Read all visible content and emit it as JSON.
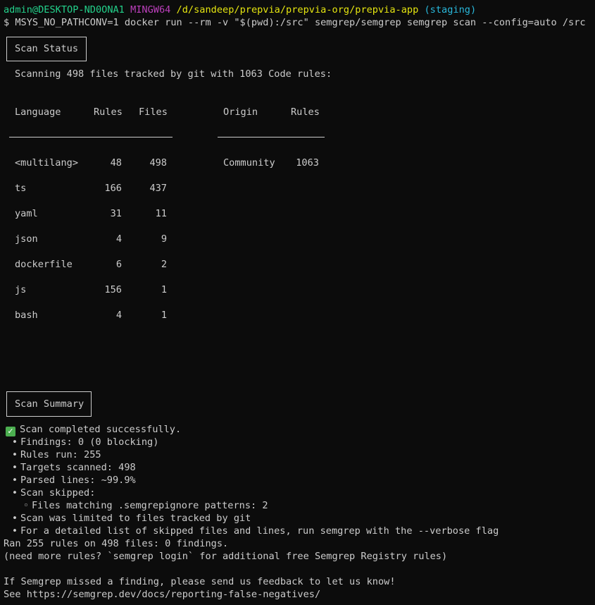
{
  "prompt": {
    "user_host": "admin@DESKTOP-ND0ONA1",
    "shell": "MINGW64",
    "path": "/d/sandeep/prepvia/prepvia-org/prepvia-app",
    "branch": "(staging)",
    "command": "$ MSYS_NO_PATHCONV=1 docker run --rm -v \"$(pwd):/src\" semgrep/semgrep semgrep scan --config=auto /src"
  },
  "scan_status": {
    "title": "Scan Status",
    "intro": "Scanning 498 files tracked by git with 1063 Code rules:",
    "lang_headers": [
      "Language",
      "Rules",
      "Files"
    ],
    "origin_headers": [
      "Origin",
      "Rules"
    ],
    "languages": [
      {
        "name": "<multilang>",
        "rules": "48",
        "files": "498"
      },
      {
        "name": "ts",
        "rules": "166",
        "files": "437"
      },
      {
        "name": "yaml",
        "rules": "31",
        "files": "11"
      },
      {
        "name": "json",
        "rules": "4",
        "files": "9"
      },
      {
        "name": "dockerfile",
        "rules": "6",
        "files": "2"
      },
      {
        "name": "js",
        "rules": "156",
        "files": "1"
      },
      {
        "name": "bash",
        "rules": "4",
        "files": "1"
      }
    ],
    "origins": [
      {
        "name": "Community",
        "rules": "1063"
      }
    ]
  },
  "scan_summary": {
    "title": "Scan Summary",
    "completed": "Scan completed successfully.",
    "bullets": [
      "Findings: 0 (0 blocking)",
      "Rules run: 255",
      "Targets scanned: 498",
      "Parsed lines: ~99.9%",
      "Scan skipped:"
    ],
    "sub_bullet": "Files matching .semgrepignore patterns: 2",
    "bullets2": [
      "Scan was limited to files tracked by git",
      "For a detailed list of skipped files and lines, run semgrep with the --verbose flag"
    ],
    "ran": "Ran 255 rules on 498 files: 0 findings.",
    "need_more": "(need more rules? `semgrep login` for additional free Semgrep Registry rules)",
    "feedback": "If Semgrep missed a finding, please send us feedback to let us know!",
    "see_link": "See https://semgrep.dev/docs/reporting-false-negatives/"
  },
  "colors": {
    "background": "#0c0c0c",
    "text": "#cccccc",
    "user": "#23d18b",
    "shell": "#bc3fbc",
    "path": "#e5e510",
    "branch": "#29b8db",
    "check": "#4caf50"
  },
  "icons": {
    "success": "check-mark-icon",
    "bullet": "bullet-icon",
    "sub_bullet": "hollow-bullet-icon"
  }
}
